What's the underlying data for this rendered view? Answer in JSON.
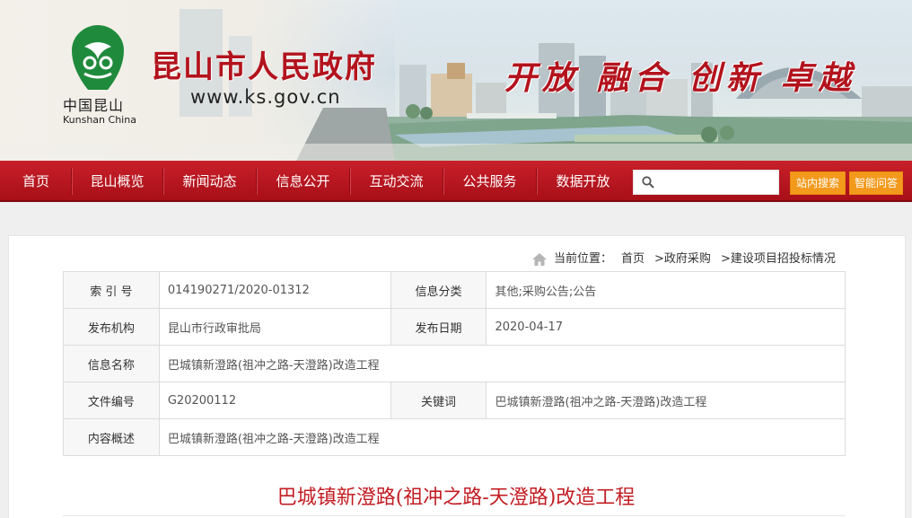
{
  "header": {
    "logo_cn": "中国昆山",
    "logo_en": "Kunshan China",
    "site_title": "昆山市人民政府",
    "site_url": "www.ks.gov.cn",
    "slogan": "开放 融合 创新 卓越"
  },
  "nav": {
    "items": [
      "首页",
      "昆山概览",
      "新闻动态",
      "信息公开",
      "互动交流",
      "公共服务",
      "数据开放"
    ],
    "search_placeholder": "",
    "site_search_label": "站内搜索",
    "smart_qa_label": "智能问答"
  },
  "breadcrumb": {
    "prefix": "当前位置：",
    "items": [
      "首页",
      ">政府采购",
      ">建设项目招投标情况"
    ]
  },
  "info_table": {
    "index_label": "索 引 号",
    "index_value": "014190271/2020-01312",
    "category_label": "信息分类",
    "category_value": "其他;采购公告;公告",
    "publisher_label": "发布机构",
    "publisher_value": "昆山市行政审批局",
    "date_label": "发布日期",
    "date_value": "2020-04-17",
    "name_label": "信息名称",
    "name_value": "巴城镇新澄路(祖冲之路-天澄路)改造工程",
    "docno_label": "文件编号",
    "docno_value": "G20200112",
    "keyword_label": "关键词",
    "keyword_value": "巴城镇新澄路(祖冲之路-天澄路)改造工程",
    "summary_label": "内容概述",
    "summary_value": "巴城镇新澄路(祖冲之路-天澄路)改造工程"
  },
  "document": {
    "title": "巴城镇新澄路(祖冲之路-天澄路)改造工程"
  },
  "colors": {
    "brand_red": "#b3131d",
    "nav_red": "#c8202a",
    "orange_button": "#f39a1c"
  }
}
